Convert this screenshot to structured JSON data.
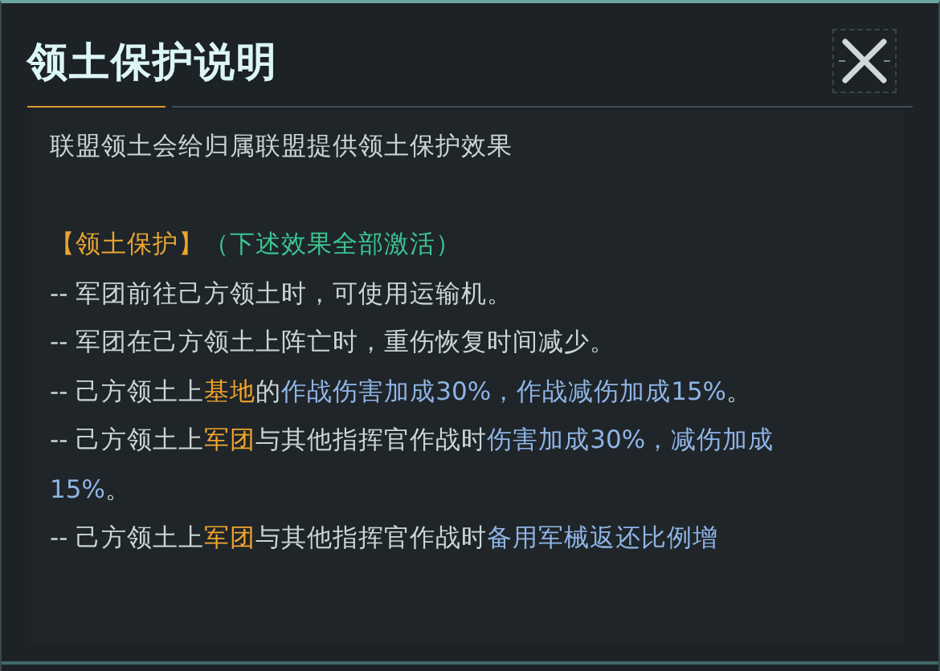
{
  "dialog": {
    "title": "领土保护说明"
  },
  "intro": "联盟领土会给归属联盟提供领土保护效果",
  "section": {
    "heading": "【领土保护】",
    "note": "（下述效果全部激活）"
  },
  "effects": [
    [
      {
        "kind": "plain",
        "text": "-- 军团前往己方领土时，可使用运输机。"
      }
    ],
    [
      {
        "kind": "plain",
        "text": "-- 军团在己方领土上阵亡时，重伤恢复时间减少。"
      }
    ],
    [
      {
        "kind": "plain",
        "text": "-- 己方领土上"
      },
      {
        "kind": "highlight",
        "text": "基地"
      },
      {
        "kind": "plain",
        "text": "的"
      },
      {
        "kind": "value",
        "text": "作战伤害加成30%，作战减伤加成15%"
      },
      {
        "kind": "plain",
        "text": "。"
      }
    ],
    [
      {
        "kind": "plain",
        "text": "-- 己方领土上"
      },
      {
        "kind": "highlight",
        "text": "军团"
      },
      {
        "kind": "plain",
        "text": "与其他指挥官作战时"
      },
      {
        "kind": "value",
        "text": "伤害加成30%，减伤加成15%"
      },
      {
        "kind": "plain",
        "text": "。"
      }
    ],
    [
      {
        "kind": "plain",
        "text": "-- 己方领土上"
      },
      {
        "kind": "highlight",
        "text": "军团"
      },
      {
        "kind": "plain",
        "text": "与其他指挥官作战时"
      },
      {
        "kind": "value",
        "text": "备用军械返还比例增"
      }
    ]
  ]
}
